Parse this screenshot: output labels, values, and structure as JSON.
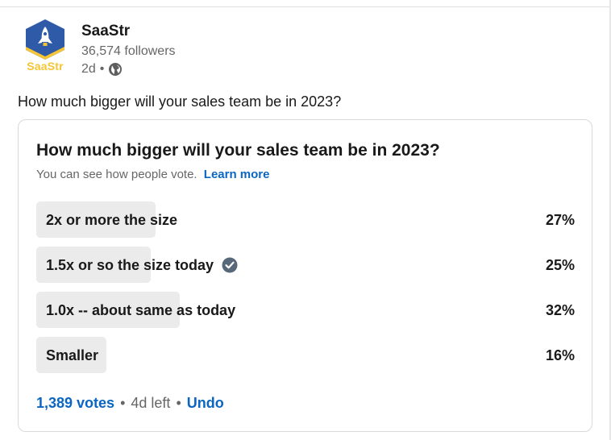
{
  "author": {
    "logo_text": "SaaStr",
    "name": "SaaStr",
    "followers": "36,574 followers",
    "posted": "2d",
    "visibility_icon": "globe-icon"
  },
  "post": {
    "text": "How much bigger will your sales team be in 2023?"
  },
  "poll": {
    "question": "How much bigger will your sales team be in 2023?",
    "visibility_note": "You can see how people vote.",
    "learn_more": "Learn more",
    "options": [
      {
        "label": "2x or more the size",
        "percent_text": "27%",
        "percent": 27,
        "selected": false
      },
      {
        "label": "1.5x or so the size today",
        "percent_text": "25%",
        "percent": 25,
        "selected": true
      },
      {
        "label": "1.0x -- about same as today",
        "percent_text": "32%",
        "percent": 32,
        "selected": false
      },
      {
        "label": "Smaller",
        "percent_text": "16%",
        "percent": 16,
        "selected": false
      }
    ],
    "votes": "1,389 votes",
    "time_left": "4d left",
    "undo": "Undo"
  },
  "colors": {
    "link": "#0a66c2",
    "bar": "#ebebeb",
    "logo_blue": "#2e5aa8",
    "logo_yellow": "#f4c534"
  }
}
